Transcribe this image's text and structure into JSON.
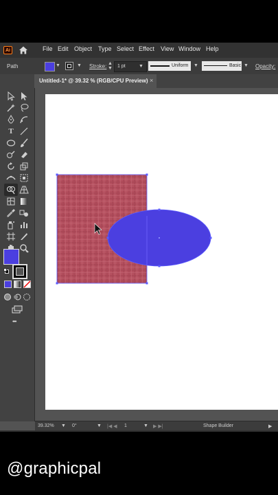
{
  "menubar": {
    "app_badge": "Ai",
    "items": [
      "File",
      "Edit",
      "Object",
      "Type",
      "Select",
      "Effect",
      "View",
      "Window",
      "Help"
    ]
  },
  "controlbar": {
    "selection_label": "Path",
    "fill_color": "#4b3fe0",
    "stroke_label": "Stroke:",
    "stroke_weight": "1 pt",
    "profile_label": "Uniform",
    "brush_label": "Basic",
    "opacity_label": "Opacity:"
  },
  "document": {
    "tab_title": "Untitled-1* @ 39.32 % (RGB/CPU Preview)",
    "close_glyph": "×"
  },
  "toolbar": {
    "fill_color": "#4b3fe0",
    "stroke_color": "#000000",
    "more_glyph": "•••"
  },
  "artwork": {
    "rectangle_fill": "#b5505f",
    "ellipse_fill": "#4b3fe0",
    "selection_color": "#5b5bff"
  },
  "statusbar": {
    "zoom": "39.32%",
    "rotation": "0°",
    "artboard_number": "1",
    "current_tool": "Shape Builder"
  },
  "watermark": {
    "handle": "@graphicpal"
  }
}
